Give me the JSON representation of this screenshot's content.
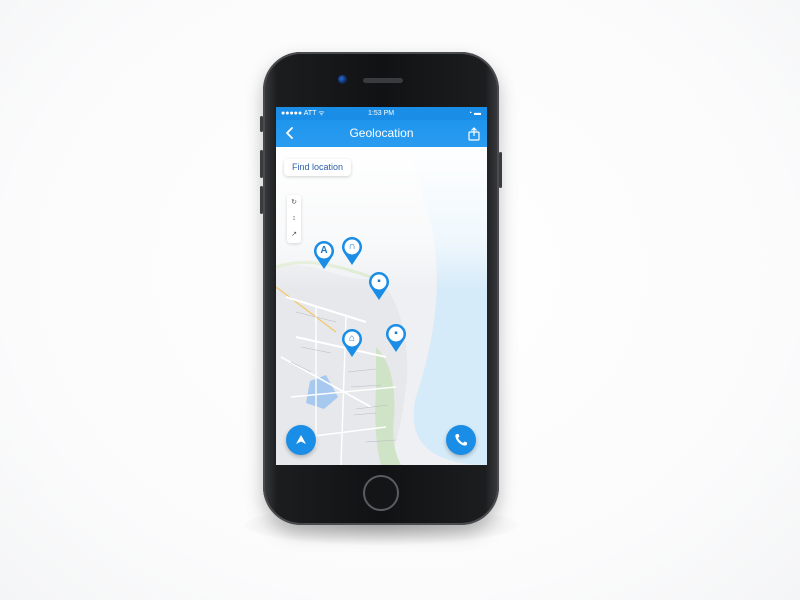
{
  "status_bar": {
    "left": "●●●●● ATT ᯤ",
    "time": "1:53 PM",
    "right": "◔ ▬"
  },
  "nav": {
    "title": "Geolocation",
    "back_icon": "chevron-left-icon",
    "action_icon": "share-icon"
  },
  "map": {
    "search_chip": "Find location",
    "controls": [
      "↻",
      "↕",
      "↗"
    ],
    "pins": [
      {
        "label": "A"
      },
      {
        "label": "∩"
      },
      {
        "label": "▪"
      },
      {
        "label": "⌂"
      },
      {
        "label": "▪"
      }
    ]
  },
  "buttons": {
    "directions_icon": "arrow-icon",
    "call_icon": "phone-icon"
  },
  "colors": {
    "accent": "#1a8de6",
    "map_water": "#cfe6f7",
    "map_land": "#e9ebee",
    "map_green": "#cfe3c6"
  }
}
